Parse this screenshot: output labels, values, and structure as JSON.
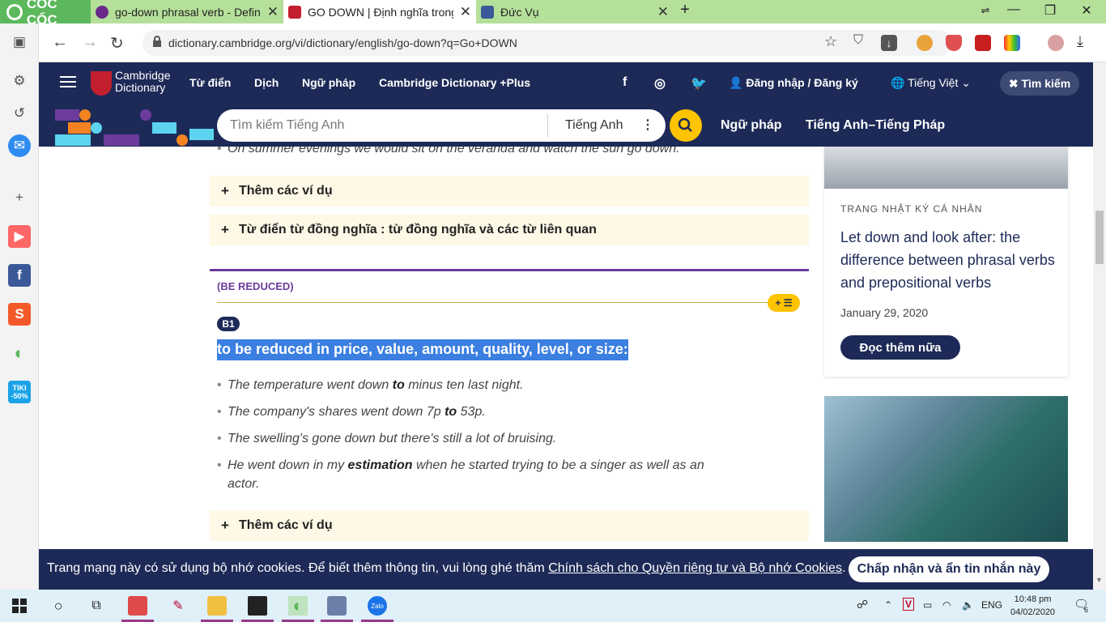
{
  "browser": {
    "brand": "CỐC CỐC",
    "tabs": [
      {
        "title": "go-down phrasal verb - Defin"
      },
      {
        "title": "GO DOWN | Định nghĩa trong"
      },
      {
        "title": "Đức Vụ"
      }
    ],
    "url": "dictionary.cambridge.org/vi/dictionary/english/go-down?q=Go+DOWN"
  },
  "header": {
    "logo_line1": "Cambridge",
    "logo_line2": "Dictionary",
    "nav": [
      "Từ điển",
      "Dịch",
      "Ngữ pháp",
      "Cambridge Dictionary +Plus"
    ],
    "login": "Đăng nhập / Đăng ký",
    "language": "Tiếng Việt",
    "search_button": "Tìm kiếm"
  },
  "searchbar": {
    "placeholder": "Tìm kiếm Tiếng Anh",
    "lang": "Tiếng Anh",
    "links": [
      "Ngữ pháp",
      "Tiếng Anh–Tiếng Pháp"
    ]
  },
  "entry": {
    "top_example": "On summer evenings we would sit on the veranda and watch the sun go down.",
    "more_examples": "Thêm các ví dụ",
    "thesaurus": "Từ điển từ đồng nghĩa : từ đồng nghĩa và các từ liên quan",
    "guideword": "(BE REDUCED)",
    "level": "B1",
    "definition": "to be reduced in price, value, amount, quality, level, or size:",
    "examples": [
      {
        "pre": "The temperature went down ",
        "bold": "to",
        "post": " minus ten last night."
      },
      {
        "pre": "The company's shares went down 7p ",
        "bold": "to",
        "post": " 53p."
      },
      {
        "pre": "The swelling's gone down but there's still a lot of bruising.",
        "bold": "",
        "post": ""
      },
      {
        "pre": "He went down in my ",
        "bold": "estimation",
        "post": " when he started trying to be a singer as well as an"
      }
    ],
    "example4_cont": "actor.",
    "more_examples2": "Thêm các ví dụ"
  },
  "sidebar": {
    "category": "TRANG NHẬT KÝ CÁ NHÂN",
    "title": "Let down and look after: the difference between phrasal verbs and prepositional verbs",
    "date": "January 29, 2020",
    "read_more": "Đọc thêm nữa"
  },
  "cookie": {
    "message": "Trang mạng này có sử dụng bộ nhớ cookies. Để biết thêm thông tin, vui lòng ghé thăm ",
    "link": "Chính sách cho Quyền riêng tư và Bộ nhớ Cookies",
    "end": ".",
    "accept": "Chấp nhận và ẩn tin nhắn này"
  },
  "sidebar_ext": {
    "tiki": "TIKI",
    "tiki_discount": "-50%"
  },
  "taskbar": {
    "lang": "ENG",
    "time": "10:48 pm",
    "date": "04/02/2020",
    "notif_count": "6"
  },
  "colors": {
    "cambridge_navy": "#1d2a57",
    "accent_yellow": "#fec400",
    "highlight_blue": "#3b7fe0",
    "coccoc_green": "#5cb85c"
  }
}
